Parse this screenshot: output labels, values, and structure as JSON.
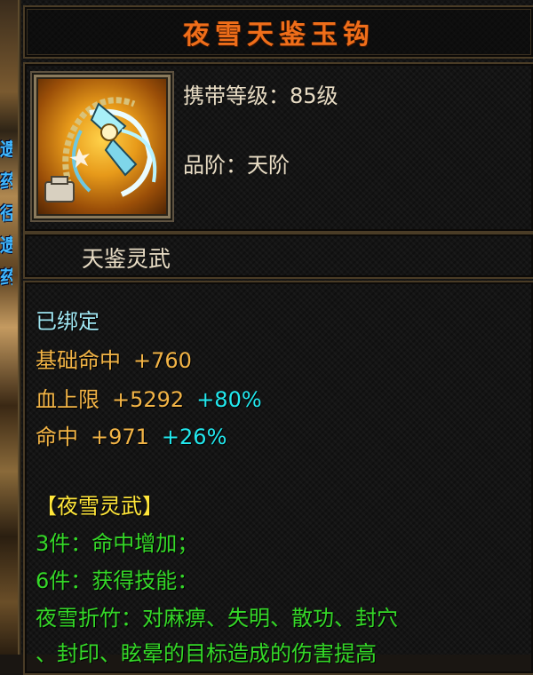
{
  "item": {
    "name": "夜雪天鉴玉钩",
    "carry_level_label": "携带等级：",
    "carry_level_value": "85级",
    "grade_label": "品阶：",
    "grade_value": "天阶",
    "set_name": "天鉴灵武",
    "icon": "hook-weapon-icon"
  },
  "background": {
    "side_chars": [
      "遗",
      "药",
      "径",
      "遗",
      "药"
    ]
  },
  "details": {
    "bound": "已绑定",
    "base_hit_label": "基础命中",
    "base_hit_value": "+760",
    "hp_label": "血上限",
    "hp_value": "+5292",
    "hp_pct": "+80%",
    "hit_label": "命中",
    "hit_value": "+971",
    "hit_pct": "+26%",
    "set_header": "【夜雪灵武】",
    "set_3": "3件：命中增加；",
    "set_6": "6件：获得技能：",
    "skill_line1": "夜雪折竹：对麻痹、失明、散功、封穴",
    "skill_line2": "、封印、眩晕的目标造成的伤害提高"
  },
  "colors": {
    "title": "#ef6e1a",
    "bound": "#9fe6f2",
    "stat_label": "#f2b446",
    "percent": "#22e8ee",
    "set_header": "#ffe63a",
    "set_bonus": "#35d828"
  }
}
